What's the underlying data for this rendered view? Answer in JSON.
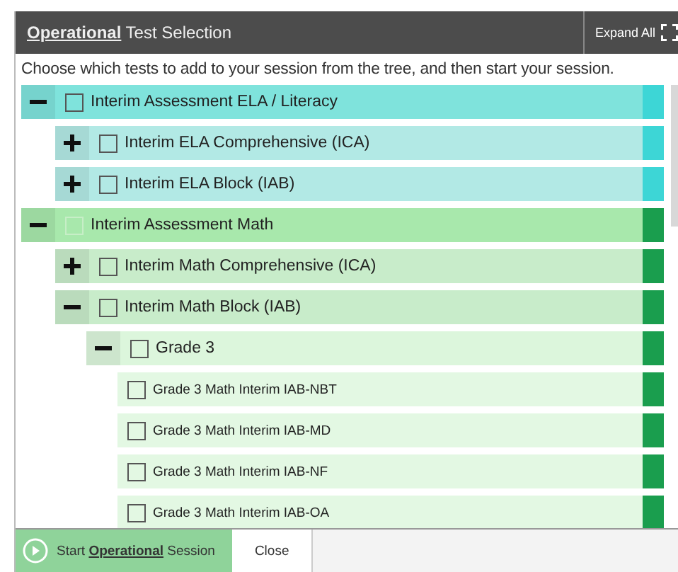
{
  "header": {
    "title_emphasis": "Operational",
    "title_rest": "Test Selection",
    "expand_all": "Expand All"
  },
  "instructions": "Choose which tests to add to your session from the tree, and then start your session.",
  "tree": [
    {
      "label": "Interim Assessment ELA / Literacy",
      "color": "#3dd6d6",
      "expanded": true,
      "checked": false,
      "disabled": false,
      "children": [
        {
          "label": "Interim ELA Comprehensive (ICA)",
          "expanded": false,
          "checked": false,
          "disabled": false
        },
        {
          "label": "Interim ELA Block (IAB)",
          "expanded": false,
          "checked": false,
          "disabled": false
        }
      ]
    },
    {
      "label": "Interim Assessment Math",
      "color": "#1a9e4e",
      "expanded": true,
      "checked": false,
      "disabled": true,
      "children": [
        {
          "label": "Interim Math Comprehensive (ICA)",
          "expanded": false,
          "checked": false,
          "disabled": false
        },
        {
          "label": "Interim Math Block (IAB)",
          "expanded": true,
          "checked": false,
          "disabled": false,
          "children": [
            {
              "label": "Grade 3",
              "expanded": true,
              "checked": false,
              "disabled": false,
              "children": [
                {
                  "label": "Grade 3 Math Interim IAB-NBT",
                  "checked": false,
                  "disabled": false
                },
                {
                  "label": "Grade 3 Math Interim IAB-MD",
                  "checked": false,
                  "disabled": false
                },
                {
                  "label": "Grade 3 Math Interim IAB-NF",
                  "checked": false,
                  "disabled": false
                },
                {
                  "label": "Grade 3 Math Interim IAB-OA",
                  "checked": false,
                  "disabled": false
                }
              ]
            }
          ]
        }
      ]
    }
  ],
  "footer": {
    "start_before": "Start",
    "start_emphasis": "Operational",
    "start_after": "Session",
    "close": "Close"
  }
}
